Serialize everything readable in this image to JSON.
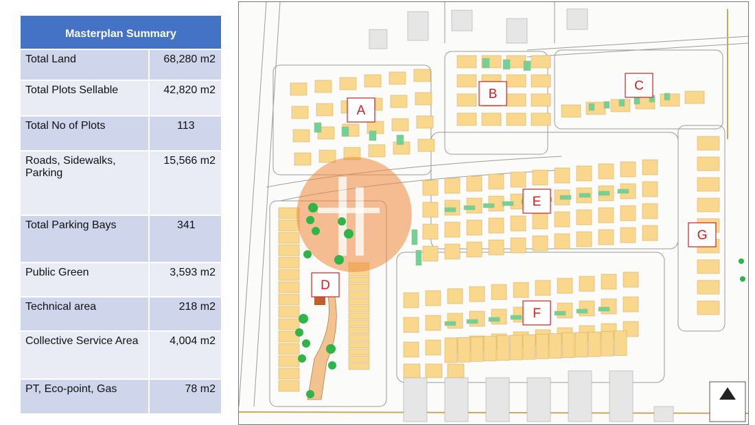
{
  "summary": {
    "title": "Masterplan Summary",
    "rows": [
      {
        "label": "Total Land",
        "value": "68,280 m2"
      },
      {
        "label": "Total Plots Sellable",
        "value": "42,820 m2"
      },
      {
        "label": "Total No of Plots",
        "value": "113"
      },
      {
        "label": "Roads, Sidewalks, Parking",
        "value": "15,566 m2"
      },
      {
        "label": "Total Parking Bays",
        "value": "341"
      },
      {
        "label": "Public Green",
        "value": "3,593 m2"
      },
      {
        "label": "Technical area",
        "value": "218 m2"
      },
      {
        "label": "Collective Service Area",
        "value": "4,004 m2"
      },
      {
        "label": "PT, Eco-point, Gas",
        "value": "78 m2"
      }
    ]
  },
  "plan": {
    "zones": [
      "A",
      "B",
      "C",
      "D",
      "E",
      "F",
      "G"
    ],
    "colors": {
      "plot": "#f9d78c",
      "green": "#6ed39a",
      "tree": "#2fb44a",
      "zone_border": "#cc2222",
      "watermark": "#f08a3c"
    }
  }
}
